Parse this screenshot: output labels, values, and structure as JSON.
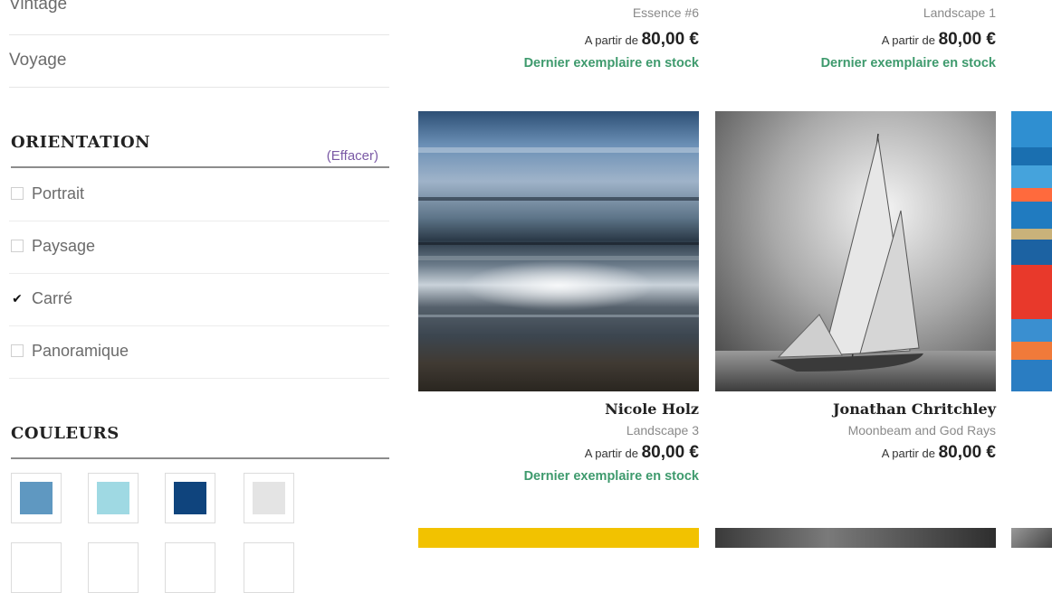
{
  "sidebar": {
    "categories": [
      "Vintage",
      "Voyage"
    ],
    "orientation": {
      "heading": "ORIENTATION",
      "clear_label": "(Effacer)",
      "options": [
        {
          "label": "Portrait",
          "checked": false
        },
        {
          "label": "Paysage",
          "checked": false
        },
        {
          "label": "Carré",
          "checked": true
        },
        {
          "label": "Panoramique",
          "checked": false
        }
      ]
    },
    "colors": {
      "heading": "COULEURS",
      "swatches": [
        "#5f98c1",
        "#9fd9e3",
        "#0f447d",
        "#e4e4e4"
      ]
    }
  },
  "products_top": [
    {
      "title": "Essence #6",
      "price_prefix": "A partir de",
      "price": "80,00 €",
      "stock": "Dernier exemplaire en stock"
    },
    {
      "title": "Landscape 1",
      "price_prefix": "A partir de",
      "price": "80,00 €",
      "stock": "Dernier exemplaire en stock"
    }
  ],
  "products_mid": [
    {
      "artist": "Nicole Holz",
      "title": "Landscape 3",
      "price_prefix": "A partir de",
      "price": "80,00 €",
      "stock": "Dernier exemplaire en stock"
    },
    {
      "artist": "Jonathan Chritchley",
      "title": "Moonbeam and God Rays",
      "price_prefix": "A partir de",
      "price": "80,00 €"
    }
  ]
}
